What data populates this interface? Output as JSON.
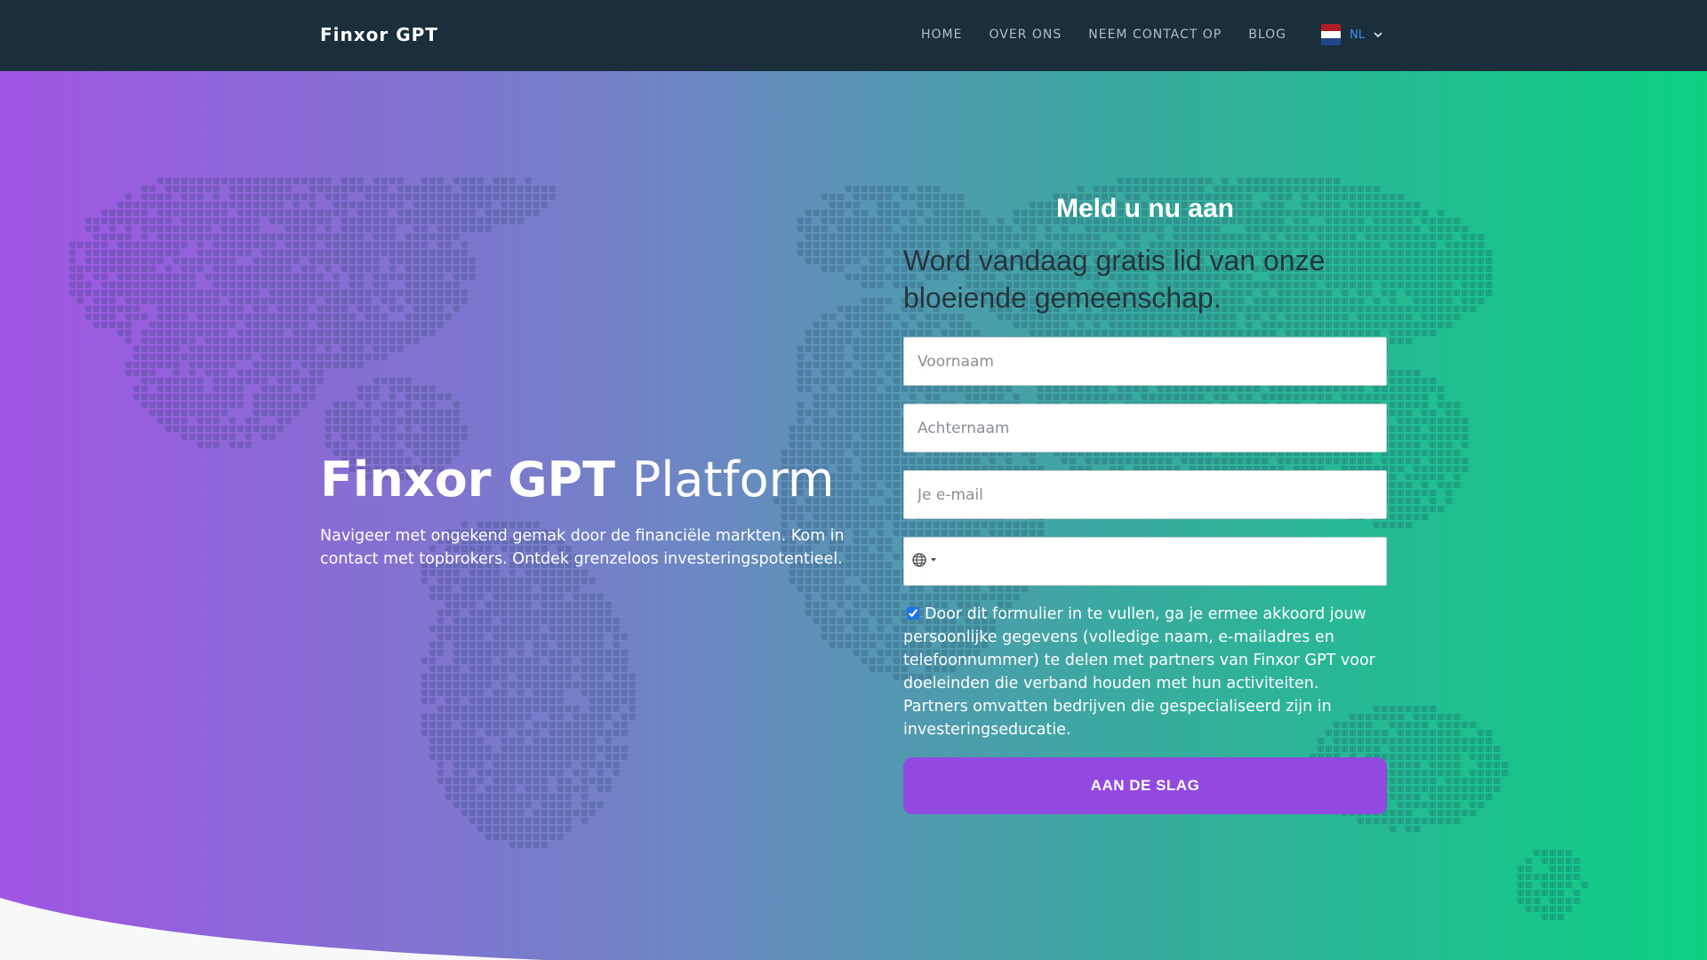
{
  "nav": {
    "brand": "Finxor GPT",
    "links": [
      {
        "label": "HOME"
      },
      {
        "label": "OVER ONS"
      },
      {
        "label": "NEEM CONTACT OP"
      },
      {
        "label": "BLOG"
      }
    ],
    "language": {
      "code": "NL",
      "flag_colors": [
        "#ae1c28",
        "#ffffff",
        "#21468b"
      ]
    }
  },
  "hero": {
    "title_bold": "Finxor GPT",
    "title_light": "Platform",
    "description": "Navigeer met ongekend gemak door de financiële markten. Kom in contact met topbrokers. Ontdek grenzeloos investeringspotentieel."
  },
  "form": {
    "heading": "Meld u nu aan",
    "subheading": "Word vandaag gratis lid van onze bloeiende gemeenschap.",
    "first_name": {
      "placeholder": "Voornaam",
      "value": ""
    },
    "last_name": {
      "placeholder": "Achternaam",
      "value": ""
    },
    "email": {
      "placeholder": "Je e-mail",
      "value": ""
    },
    "phone": {
      "value": "",
      "country_icon": "globe-icon"
    },
    "consent": {
      "checked": true,
      "text": "Door dit formulier in te vullen, ga je ermee akkoord jouw persoonlijke gegevens (volledige naam, e-mailadres en telefoonnummer) te delen met partners van Finxor GPT voor doeleinden die verband houden met hun activiteiten. Partners omvatten bedrijven die gespecialiseerd zijn in investeringseducatie."
    },
    "submit_label": "AAN DE SLAG"
  },
  "colors": {
    "navbar": "#1a2e3b",
    "gradient_start": "#a055e3",
    "gradient_end": "#0ccf82",
    "button": "#9249e0",
    "lang_accent": "#3b8ff3"
  }
}
